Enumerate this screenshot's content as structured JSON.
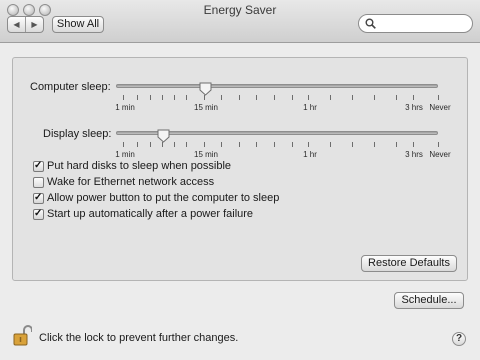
{
  "window": {
    "title": "Energy Saver"
  },
  "toolbar": {
    "back_icon": "triangle-left",
    "forward_icon": "triangle-right",
    "show_all_label": "Show All"
  },
  "search": {
    "value": "",
    "placeholder": ""
  },
  "sliders": {
    "computer_sleep": {
      "label": "Computer sleep:",
      "value_label": "15 min"
    },
    "display_sleep": {
      "label": "Display sleep:",
      "value_label": "10 min"
    },
    "scale": {
      "min": "1 min",
      "min15": "15 min",
      "hr1": "1 hr",
      "hrs3": "3 hrs",
      "never": "Never"
    }
  },
  "options": [
    {
      "label": "Put hard disks to sleep when possible",
      "checked": true
    },
    {
      "label": "Wake for Ethernet network access",
      "checked": false
    },
    {
      "label": "Allow power button to put the computer to sleep",
      "checked": true
    },
    {
      "label": "Start up automatically after a power failure",
      "checked": true
    }
  ],
  "buttons": {
    "restore_defaults": "Restore Defaults",
    "schedule": "Schedule..."
  },
  "footer": {
    "lock_text": "Click the lock to prevent further changes.",
    "help_label": "?"
  }
}
